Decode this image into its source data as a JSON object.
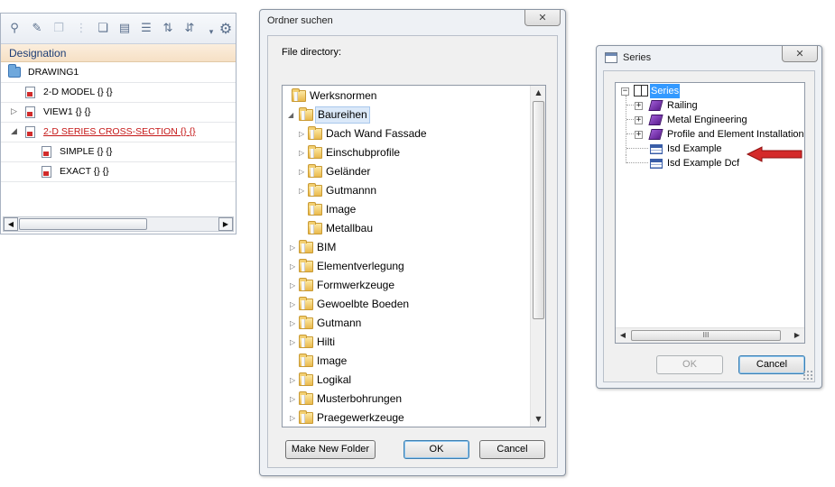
{
  "left_panel": {
    "header": "Designation",
    "rows": [
      {
        "label": "DRAWING1"
      },
      {
        "label": "2-D MODEL {} {}"
      },
      {
        "label": "VIEW1 {} {}"
      },
      {
        "label": "2-D SERIES CROSS-SECTION {} {}",
        "color": "#c51818"
      },
      {
        "label": "SIMPLE {} {}"
      },
      {
        "label": "EXACT {} {}"
      }
    ],
    "toolbar_icons": [
      "search-icon",
      "pin-icon",
      "copy-icon",
      "paste-icon",
      "clipboard-icon",
      "tree-icon",
      "level-2-icon",
      "level-3-icon",
      "dropdown-icon",
      "gear-icon"
    ]
  },
  "folder_dialog": {
    "title": "Ordner suchen",
    "label": "File directory:",
    "items": [
      {
        "label": "Werksnormen"
      },
      {
        "label": "Baureihen"
      },
      {
        "label": "Dach Wand Fassade"
      },
      {
        "label": "Einschubprofile"
      },
      {
        "label": "Geländer"
      },
      {
        "label": "Gutmannn"
      },
      {
        "label": "Image"
      },
      {
        "label": "Metallbau"
      },
      {
        "label": "BIM"
      },
      {
        "label": "Elementverlegung"
      },
      {
        "label": "Formwerkzeuge"
      },
      {
        "label": "Gewoelbte Boeden"
      },
      {
        "label": "Gutmann"
      },
      {
        "label": "Hilti"
      },
      {
        "label": "Image"
      },
      {
        "label": "Logikal"
      },
      {
        "label": "Musterbohrungen"
      },
      {
        "label": "Praegewerkzeuge"
      }
    ],
    "buttons": {
      "new_folder": "Make New Folder",
      "ok": "OK",
      "cancel": "Cancel"
    },
    "close_glyph": "✕"
  },
  "series_dialog": {
    "title": "Series",
    "items": [
      {
        "label": "Series"
      },
      {
        "label": "Railing"
      },
      {
        "label": "Metal Engineering"
      },
      {
        "label": "Profile and Element Installation"
      },
      {
        "label": "Isd Example"
      },
      {
        "label": "Isd Example Dcf"
      }
    ],
    "buttons": {
      "ok": "OK",
      "cancel": "Cancel"
    },
    "close_glyph": "✕",
    "scroll_grip": "III"
  },
  "annotation": {
    "arrow_color": "#d42a2a"
  }
}
